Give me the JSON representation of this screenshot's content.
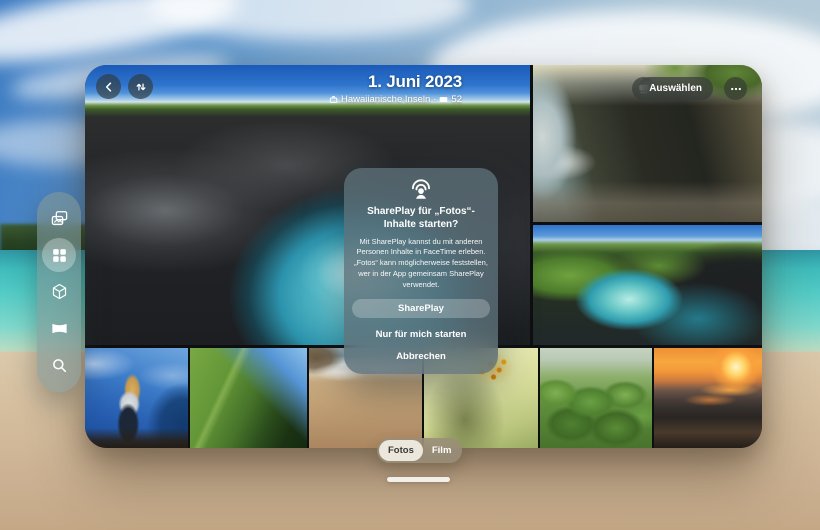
{
  "window": {
    "header": {
      "date": "1. Juni 2023",
      "location": "Hawaiianische Inseln",
      "separator": "·",
      "count": "52",
      "select_button": "Auswählen"
    },
    "photos": {
      "hero": "Black lava rock cove with turquoise surf under blue sky",
      "top_right": "Dark cliff overhang above sandy beach and sea",
      "mid_right": "Black rock coastline with green shore and teal cove",
      "bottom_1": "Woman with blonde hair on shore under deep blue sky",
      "bottom_2": "Steep green mountain ridge",
      "bottom_3": "Sandy beach with breaking waves",
      "bottom_4": "Pale yellow flower close-up with orange stamens",
      "bottom_5": "Prickly pear cactus pads",
      "bottom_6": "Orange ocean sunset"
    }
  },
  "dialog": {
    "title": "SharePlay für „Fotos“-Inhalte starten?",
    "body": "Mit SharePlay kannst du mit anderen Personen Inhalte in FaceTime erleben. „Fotos“ kann möglicherweise feststellen, wer in der App gemeinsam SharePlay verwendet.",
    "primary": "SharePlay",
    "secondary": "Nur für mich starten",
    "cancel": "Abbrechen"
  },
  "toggle": {
    "fotos": "Fotos",
    "film": "Film",
    "selected": "Fotos"
  },
  "sidebar": {
    "items": [
      {
        "icon": "photos-library-icon",
        "selected": false
      },
      {
        "icon": "albums-grid-icon",
        "selected": true
      },
      {
        "icon": "spatial-cube-icon",
        "selected": false
      },
      {
        "icon": "panorama-icon",
        "selected": false
      },
      {
        "icon": "search-icon",
        "selected": false
      }
    ]
  },
  "colors": {
    "sea_turquoise": "#4fc8c4",
    "sand": "#d5bf9f",
    "dialog_glass": "#5c6e76",
    "sidebar_glass": "#809696",
    "toggle_selected_bg": "#ece7dc"
  }
}
